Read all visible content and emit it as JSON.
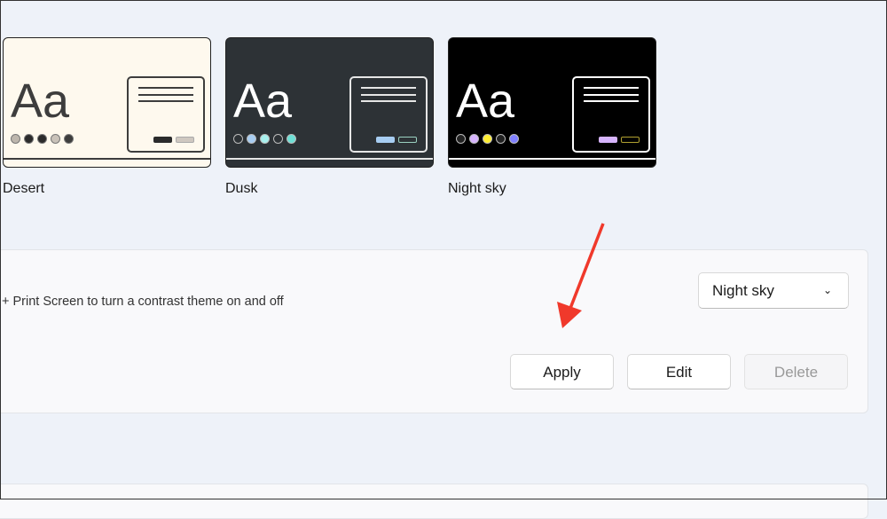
{
  "themes": [
    {
      "name": "Desert",
      "sample": "Aa",
      "bg": "#fef9ee",
      "fg": "#3d3d3d",
      "line": "#3d3d3d",
      "dots": [
        "#bdb6ad",
        "#2b2b2b",
        "#2b2b2b",
        "#c9c2b9",
        "#3d3d3d"
      ],
      "b1": "#2b2b2b",
      "b2": "#cfc8c0"
    },
    {
      "name": "Dusk",
      "sample": "Aa",
      "bg": "#2d3236",
      "fg": "#ffffff",
      "line": "#e6e6e6",
      "dots": [
        "#2d3236",
        "#a7cdf2",
        "#a7f0ee",
        "#2d3236",
        "#6ee0d6"
      ],
      "b1": "#a7cdf2",
      "b2": "#2d3236"
    },
    {
      "name": "Night sky",
      "sample": "Aa",
      "bg": "#000000",
      "fg": "#ffffff",
      "line": "#ffffff",
      "dots": [
        "#222",
        "#d6b4fd",
        "#ffee32",
        "#222",
        "#8080ff"
      ],
      "b1": "#d6b4fd",
      "b2": "#000000"
    }
  ],
  "shortcut_text": "+ Print Screen to turn a contrast theme on and off",
  "theme_dropdown": {
    "selected": "Night sky",
    "chevron": "chevron-down-icon"
  },
  "buttons": {
    "apply": "Apply",
    "edit": "Edit",
    "delete": "Delete"
  },
  "annotation_color": "#f0392b"
}
